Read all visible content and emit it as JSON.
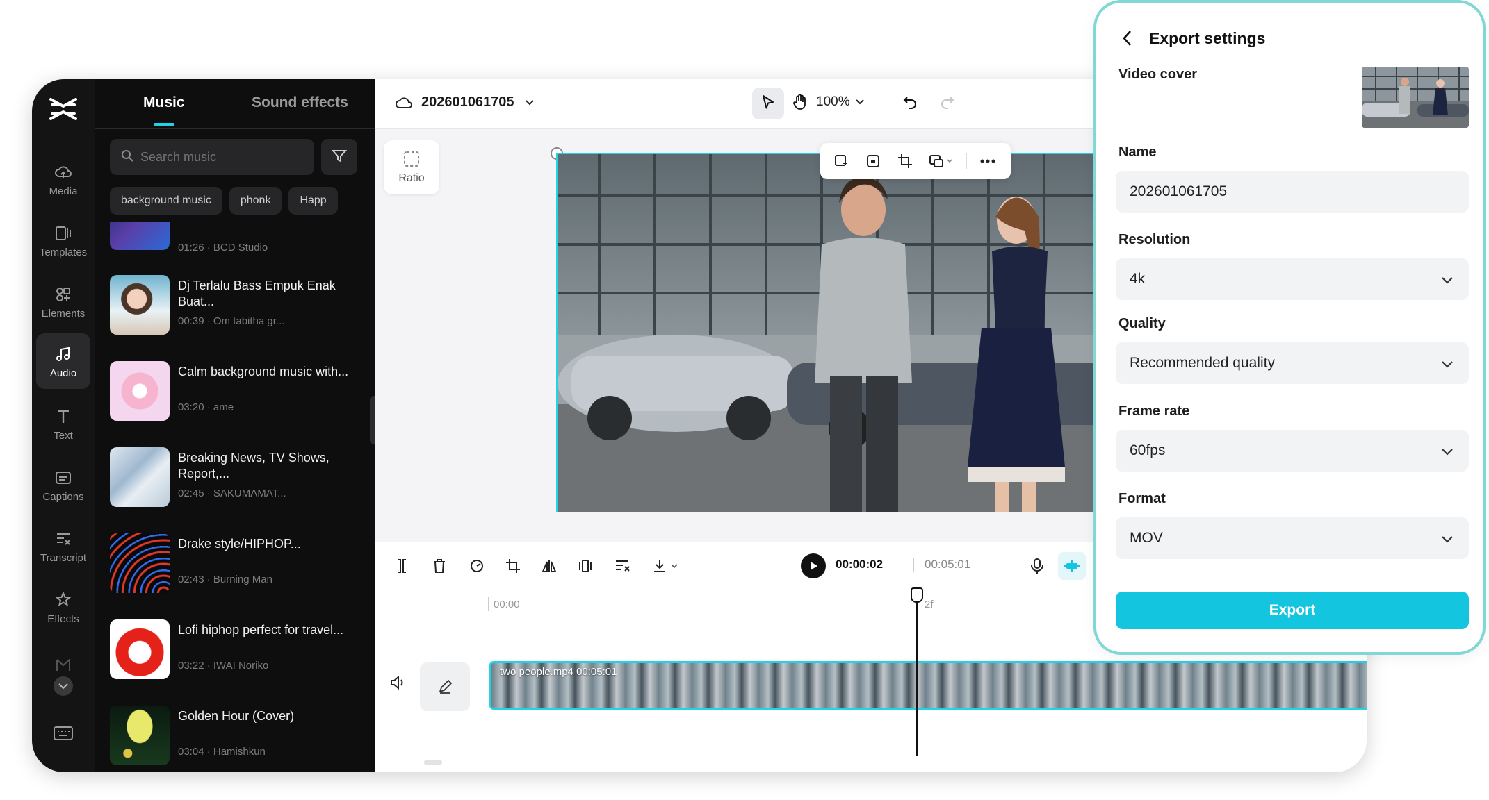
{
  "rail": {
    "items": [
      {
        "label": "Media",
        "icon": "cloud-icon"
      },
      {
        "label": "Templates",
        "icon": "templates-icon"
      },
      {
        "label": "Elements",
        "icon": "elements-icon"
      },
      {
        "label": "Audio",
        "icon": "music-note-icon"
      },
      {
        "label": "Text",
        "icon": "text-icon"
      },
      {
        "label": "Captions",
        "icon": "captions-icon"
      },
      {
        "label": "Transcript",
        "icon": "transcript-icon"
      },
      {
        "label": "Effects",
        "icon": "effects-icon"
      }
    ],
    "active": "Audio"
  },
  "panel": {
    "tabs": {
      "music": "Music",
      "sound_effects": "Sound effects"
    },
    "search_placeholder": "Search music",
    "chips": [
      "background music",
      "phonk",
      "Happ"
    ],
    "tracks": [
      {
        "title": "",
        "meta": "01:26 · BCD Studio"
      },
      {
        "title": "Dj Terlalu Bass Empuk Enak Buat...",
        "meta": "00:39 · Om tabitha gr..."
      },
      {
        "title": "Calm background music with...",
        "meta": "03:20 · ame"
      },
      {
        "title": "Breaking News, TV Shows, Report,...",
        "meta": "02:45 · SAKUMAMAT..."
      },
      {
        "title": "Drake style/HIPHOP...",
        "meta": "02:43 · Burning Man"
      },
      {
        "title": "Lofi hiphop perfect for travel...",
        "meta": "03:22 · IWAI Noriko"
      },
      {
        "title": "Golden Hour (Cover)",
        "meta": "03:04 · Hamishkun"
      }
    ]
  },
  "topbar": {
    "project_name": "202601061705",
    "zoom": "100%"
  },
  "canvas": {
    "ratio_label": "Ratio"
  },
  "player": {
    "current_time": "00:00:02",
    "total_time": "00:05:01"
  },
  "timeline": {
    "ruler_start": "00:00",
    "ruler_mark": "2f",
    "clip_label": "two people.mp4   00:05:01"
  },
  "export": {
    "title": "Export settings",
    "video_cover_label": "Video cover",
    "name_label": "Name",
    "name_value": "202601061705",
    "resolution_label": "Resolution",
    "resolution_value": "4k",
    "quality_label": "Quality",
    "quality_value": "Recommended quality",
    "frame_rate_label": "Frame rate",
    "frame_rate_value": "60fps",
    "format_label": "Format",
    "format_value": "MOV",
    "export_button": "Export",
    "accent": "#14c5e0"
  }
}
